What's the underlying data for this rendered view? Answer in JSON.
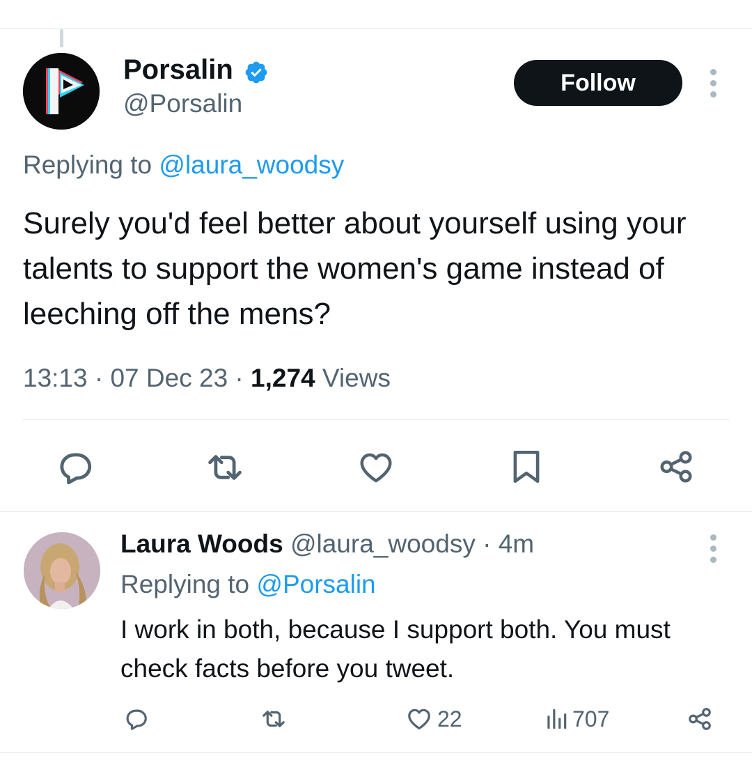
{
  "tweet": {
    "author_name": "Porsalin",
    "author_handle": "@Porsalin",
    "follow_label": "Follow",
    "replying_prefix": "Replying to ",
    "replying_to": "@laura_woodsy",
    "text": "Surely you'd feel better about yourself using your talents to support the women's game instead of leeching off the mens?",
    "time": "13:13",
    "date": "07 Dec 23",
    "views_count": "1,274",
    "views_label": "Views"
  },
  "reply": {
    "author_name": "Laura Woods",
    "author_handle": "@laura_woodsy",
    "time_ago": "4m",
    "replying_prefix": "Replying to ",
    "replying_to": "@Porsalin",
    "text": "I work in both, because I support both. You must check facts before you tweet.",
    "likes": "22",
    "views": "707"
  },
  "icons": {
    "verified": "verified-badge-icon",
    "reply": "reply-icon",
    "retweet": "retweet-icon",
    "like": "heart-icon",
    "bookmark": "bookmark-icon",
    "share": "share-icon",
    "views": "views-icon",
    "more": "more-icon"
  },
  "colors": {
    "accent": "#1d9bf0",
    "text": "#0f1419",
    "secondary": "#536471",
    "icon": "#536471",
    "divider": "#e6e9ec"
  }
}
